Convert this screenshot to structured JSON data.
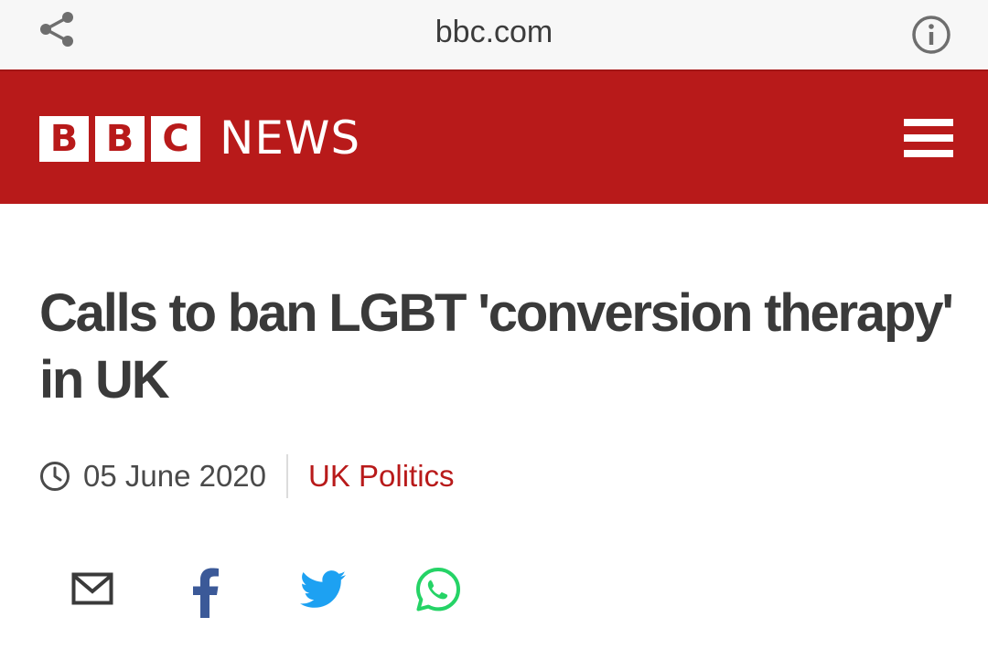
{
  "browser": {
    "domain": "bbc.com",
    "share_icon": "share-icon",
    "info_icon": "info-icon"
  },
  "masthead": {
    "logo_letters": [
      "B",
      "B",
      "C"
    ],
    "logo_word": "NEWS",
    "menu_icon": "hamburger-menu-icon",
    "brand_color": "#b81a1a"
  },
  "article": {
    "headline": "Calls to ban LGBT 'conversion therapy' in UK",
    "date": "05 June 2020",
    "section": "UK Politics",
    "section_color": "#b81a1a"
  },
  "share": {
    "buttons": [
      {
        "icon": "email-icon",
        "color": "#3a3a3a"
      },
      {
        "icon": "facebook-icon",
        "color": "#3b5998"
      },
      {
        "icon": "twitter-icon",
        "color": "#1da1f2"
      },
      {
        "icon": "whatsapp-icon",
        "color": "#25d366"
      }
    ]
  }
}
